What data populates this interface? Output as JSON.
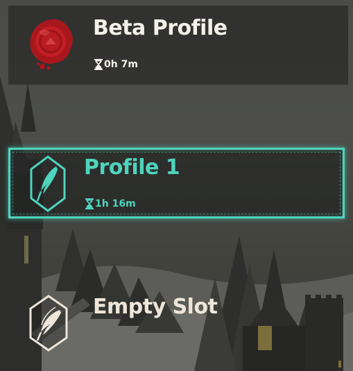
{
  "profiles": [
    {
      "name": "Beta Profile",
      "playtime": "0h 7m",
      "icon": "wax-seal-icon",
      "state": "normal"
    },
    {
      "name": "Profile 1",
      "playtime": "1h 16m",
      "icon": "quill-hexagon-icon",
      "state": "selected"
    },
    {
      "name": "Empty Slot",
      "icon": "quill-hexagon-outline-icon",
      "state": "empty"
    }
  ],
  "colors": {
    "accent": "#4fd4bd",
    "text": "#f4f1ea",
    "seal": "#b3191e"
  }
}
